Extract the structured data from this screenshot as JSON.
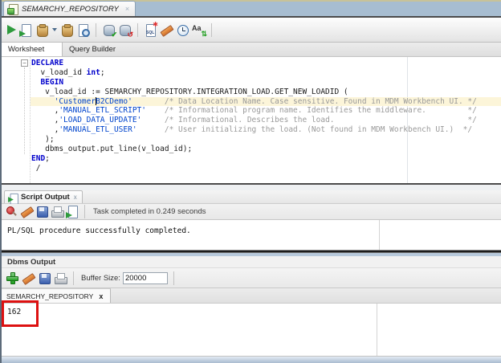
{
  "doc_tab": {
    "title": "SEMARCHY_REPOSITORY",
    "close": "×"
  },
  "main_toolbar": {
    "icons": [
      "run-statement-icon",
      "run-script-icon",
      "autotrace-icon",
      "explain-plan-icon",
      "query-preview-icon",
      "commit-database-icon",
      "rollback-database-icon",
      "unshared-worksheet-icon",
      "clear-eraser-icon",
      "sql-history-clock-icon",
      "case-toggle-icon"
    ]
  },
  "worksheet_tabs": {
    "worksheet": "Worksheet",
    "query_builder": "Query Builder"
  },
  "editor": {
    "current_line_index": 4,
    "fold_marker": "−",
    "lines": [
      [
        {
          "c": "kw",
          "t": "DECLARE"
        }
      ],
      [
        {
          "c": "pl",
          "t": "  v_load_id "
        },
        {
          "c": "kw",
          "t": "int"
        },
        {
          "c": "pl",
          "t": ";"
        }
      ],
      [
        {
          "c": "pl",
          "t": "  "
        },
        {
          "c": "kw",
          "t": "BEGIN"
        }
      ],
      [
        {
          "c": "pl",
          "t": "   v_load_id := SEMARCHY_REPOSITORY.INTEGRATION_LOAD.GET_NEW_LOADID ("
        }
      ],
      [
        {
          "c": "pl",
          "t": "     "
        },
        {
          "c": "str",
          "t": "'Customer"
        },
        {
          "c": "caret",
          "t": ""
        },
        {
          "c": "str",
          "t": "B2CDemo'"
        },
        {
          "c": "pl",
          "t": "       "
        },
        {
          "c": "com",
          "t": "/* Data Location Name. Case sensitive. Found in MDM Workbench UI. */"
        }
      ],
      [
        {
          "c": "pl",
          "t": "     ,"
        },
        {
          "c": "str",
          "t": "'MANUAL_ETL_SCRIPT'"
        },
        {
          "c": "pl",
          "t": "    "
        },
        {
          "c": "com",
          "t": "/* Informational program name. Identifies the middleware.         */"
        }
      ],
      [
        {
          "c": "pl",
          "t": "     ,"
        },
        {
          "c": "str",
          "t": "'LOAD_DATA_UPDATE'"
        },
        {
          "c": "pl",
          "t": "     "
        },
        {
          "c": "com",
          "t": "/* Informational. Describes the load.                             */"
        }
      ],
      [
        {
          "c": "pl",
          "t": "     ,"
        },
        {
          "c": "str",
          "t": "'MANUAL_ETL_USER'"
        },
        {
          "c": "pl",
          "t": "      "
        },
        {
          "c": "com",
          "t": "/* User initializing the load. (Not found in MDM Workbench UI.)  */"
        }
      ],
      [
        {
          "c": "pl",
          "t": "   );"
        }
      ],
      [
        {
          "c": "pl",
          "t": "   dbms_output.put_line(v_load_id);"
        }
      ],
      [
        {
          "c": "kw",
          "t": "END"
        },
        {
          "c": "pl",
          "t": ";"
        }
      ],
      [
        {
          "c": "pl",
          "t": " /"
        }
      ]
    ]
  },
  "splitter": {
    "up": "▲",
    "down": "▼"
  },
  "script_output": {
    "tab_label": "Script Output",
    "tab_close": "x",
    "status_text": "Task completed in 0.249 seconds",
    "output_text": "PL/SQL procedure successfully completed.",
    "toolbar_icons": [
      "pushpin-icon",
      "clear-eraser-icon",
      "save-icon",
      "print-icon",
      "run-script-icon"
    ]
  },
  "dbms_output": {
    "panel_title": "Dbms Output",
    "buffer_size_label": "Buffer Size:",
    "buffer_size_value": "20000",
    "tab_label": "SEMARCHY_REPOSITORY",
    "tab_close": "x",
    "output_value": "162",
    "toolbar_icons": [
      "add-icon",
      "clear-eraser-icon",
      "save-icon",
      "print-icon"
    ]
  },
  "colors": {
    "annotation_red": "#dd1111",
    "keyword_blue": "#0000cc",
    "string_blue": "#0044cc",
    "comment_gray": "#9a9a9a",
    "current_line_bg": "#fcf5d9",
    "tabbar_fill_blue": "#a7bdd1"
  }
}
